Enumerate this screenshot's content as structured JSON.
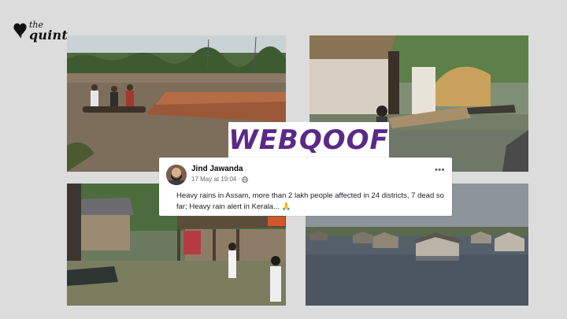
{
  "brand": {
    "logo_line1": "the",
    "logo_line2": "quint"
  },
  "badge": {
    "label": "WEBQOOF"
  },
  "post": {
    "author": "Jind Jawanda",
    "timestamp": "17 May at 19:04 ·",
    "privacy_icon": "globe-icon",
    "more_label": "•••",
    "text": "Heavy rains in Assam, more than 2 lakh people affected in 24 districts, 7 dead so far; Heavy rain alert in Kerala... 🙏"
  },
  "colors": {
    "background": "#dcdcdc",
    "badge_text": "#5b2a86",
    "logo": "#111111"
  }
}
